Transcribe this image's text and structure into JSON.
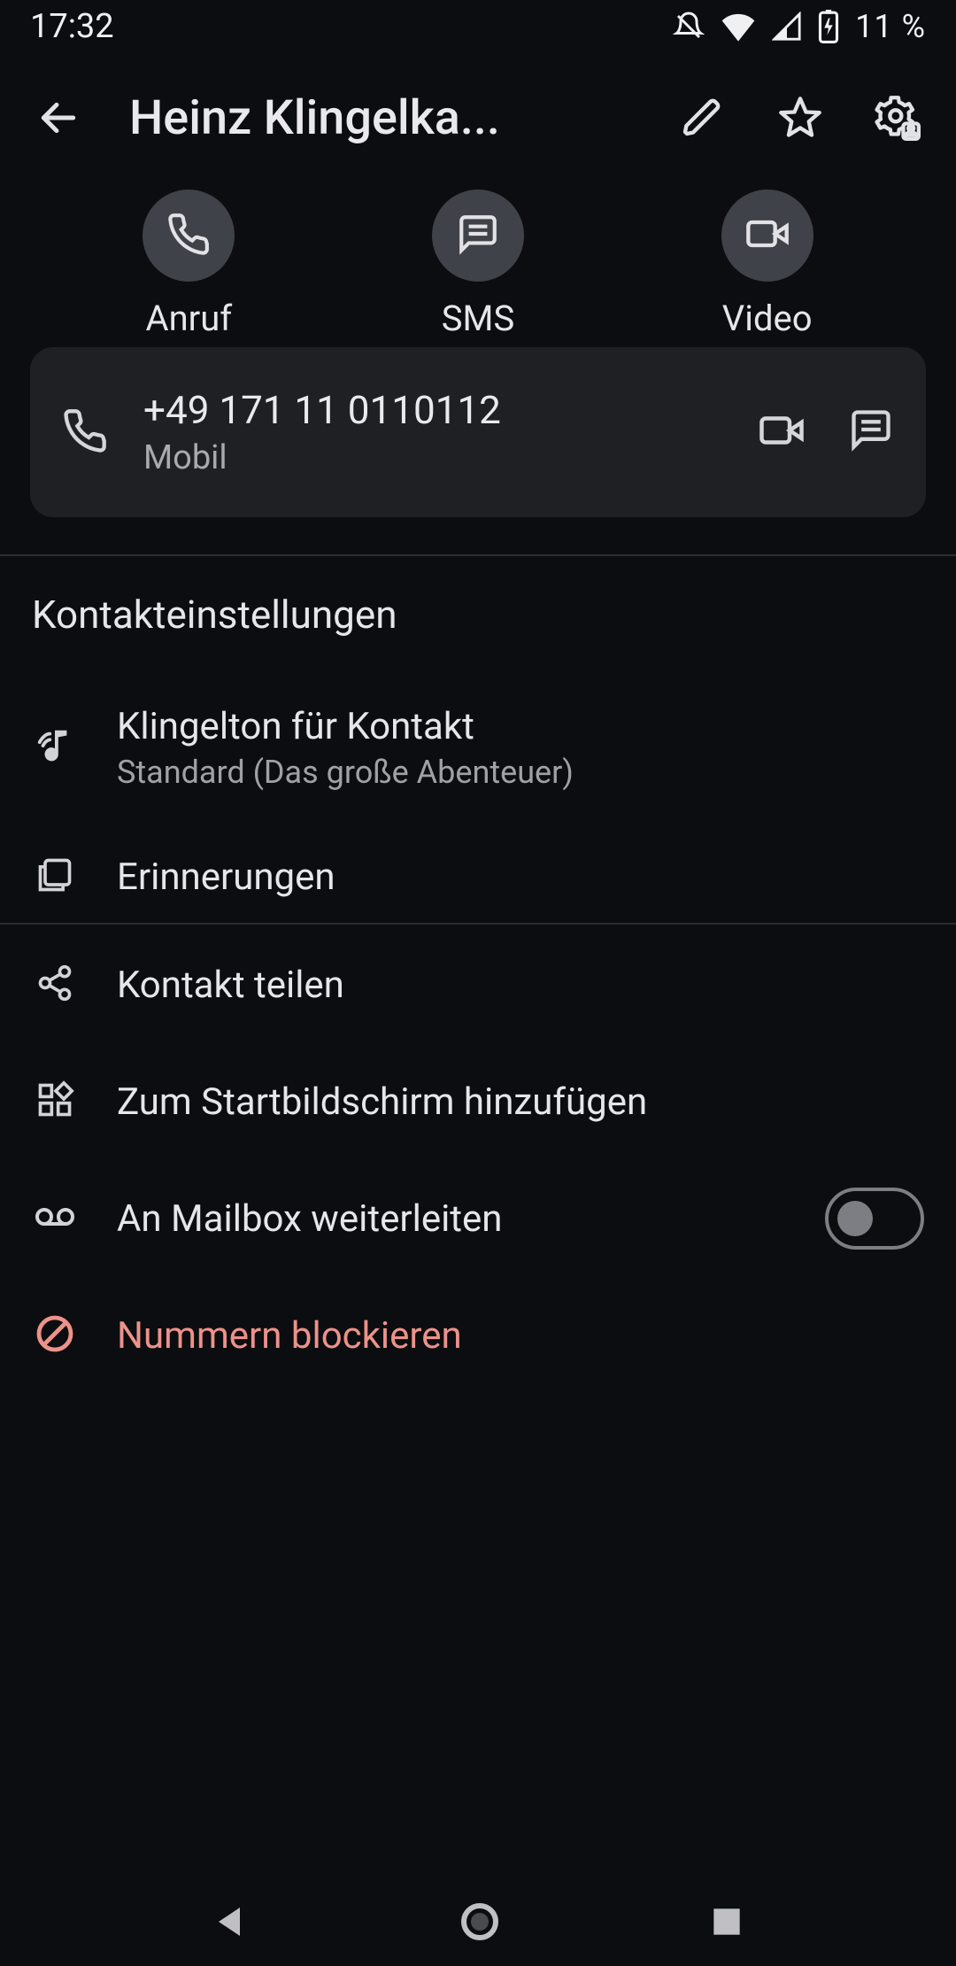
{
  "status": {
    "time": "17:32",
    "battery": "11 %"
  },
  "header": {
    "title": "Heinz Klingelka..."
  },
  "quick_actions": {
    "call": "Anruf",
    "sms": "SMS",
    "video": "Video"
  },
  "phone": {
    "number": "+49 171 11 0110112",
    "label": "Mobil"
  },
  "section": {
    "title": "Kontakteinstellungen"
  },
  "rows": {
    "ringtone": {
      "title": "Klingelton für Kontakt",
      "sub": "Standard (Das große Abenteuer)"
    },
    "reminders": "Erinnerungen",
    "share": "Kontakt teilen",
    "homescreen": "Zum Startbildschirm hinzufügen",
    "voicemail": "An Mailbox weiterleiten",
    "block": "Nummern blockieren"
  }
}
